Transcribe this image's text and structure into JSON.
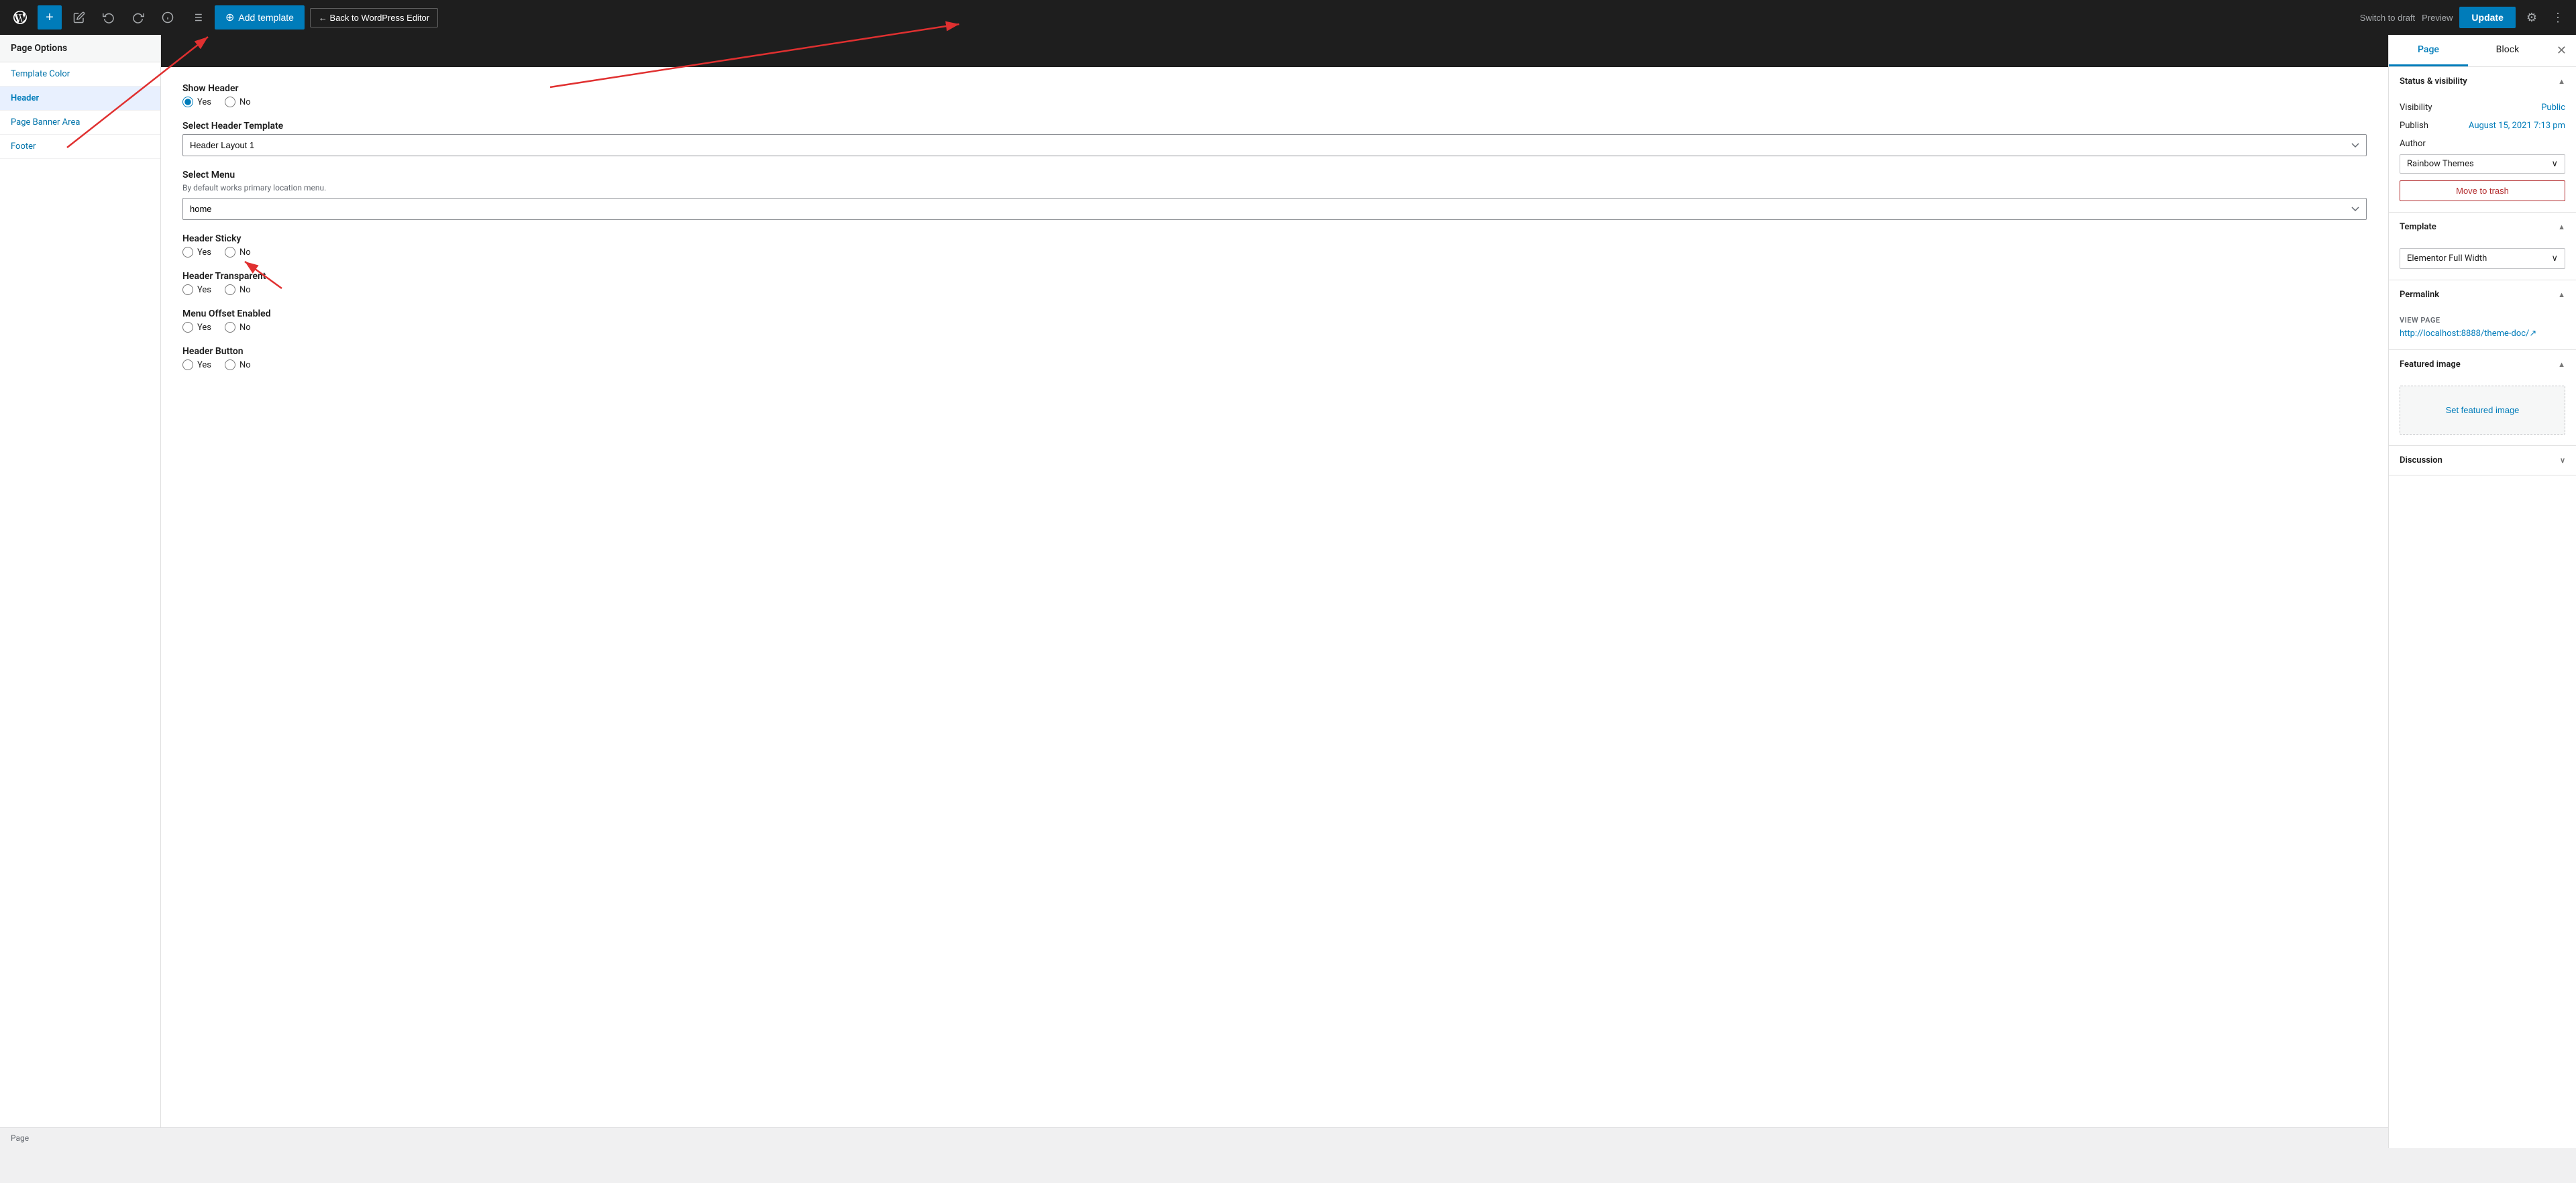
{
  "toolbar": {
    "add_template_label": "Add template",
    "back_to_wp_label": "← Back to WordPress Editor",
    "switch_to_draft_label": "Switch to draft",
    "preview_label": "Preview",
    "update_label": "Update"
  },
  "right_sidebar": {
    "tab_page": "Page",
    "tab_block": "Block",
    "status_visibility_title": "Status & visibility",
    "visibility_label": "Visibility",
    "visibility_value": "Public",
    "publish_label": "Publish",
    "publish_value": "August 15, 2021 7:13 pm",
    "author_label": "Author",
    "author_value": "Rainbow Themes",
    "move_to_trash_label": "Move to trash",
    "template_title": "Template",
    "template_value": "Elementor Full Width",
    "permalink_title": "Permalink",
    "view_page_label": "VIEW PAGE",
    "view_page_url": "http://localhost:8888/theme-doc/↗",
    "featured_image_title": "Featured image",
    "set_featured_image_label": "Set featured image",
    "discussion_title": "Discussion"
  },
  "page_options": {
    "title": "Page Options",
    "nav_items": [
      {
        "label": "Template Color"
      },
      {
        "label": "Header"
      },
      {
        "label": "Page Banner Area"
      },
      {
        "label": "Footer"
      }
    ],
    "show_header_label": "Show Header",
    "show_header_yes": "Yes",
    "show_header_no": "No",
    "select_header_template_label": "Select Header Template",
    "header_template_value": "Header Layout 1",
    "select_menu_label": "Select Menu",
    "select_menu_sublabel": "By default works primary location menu.",
    "select_menu_value": "home",
    "header_sticky_label": "Header Sticky",
    "header_sticky_yes": "Yes",
    "header_sticky_no": "No",
    "header_transparent_label": "Header Transparent",
    "header_transparent_yes": "Yes",
    "header_transparent_no": "No",
    "menu_offset_label": "Menu Offset Enabled",
    "menu_offset_yes": "Yes",
    "menu_offset_no": "No",
    "header_button_label": "Header Button",
    "header_button_yes": "Yes",
    "header_button_no": "No"
  },
  "bottom_bar": {
    "label": "Page"
  }
}
